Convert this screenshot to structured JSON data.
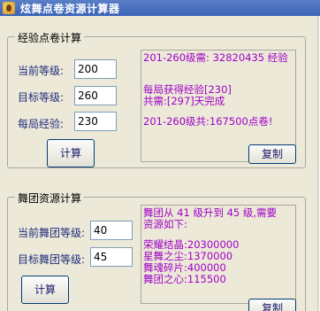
{
  "window": {
    "title": "炫舞点卷资源计算器"
  },
  "exp_group": {
    "title": "经验点卷计算",
    "labels": {
      "current_level": "当前等级:",
      "target_level": "目标等级:",
      "exp_per_round": "每局经验:"
    },
    "values": {
      "current_level": "200",
      "target_level": "260",
      "exp_per_round": "230"
    },
    "calc_label": "计算",
    "copy_label": "复制",
    "output_lines": [
      "201-260级需:  32820435 经验",
      "",
      "每局获得经验[230]",
      "共需:[297]天完成",
      "",
      "201-260级共:167500点卷!"
    ]
  },
  "team_group": {
    "title": "舞团资源计算",
    "labels": {
      "current_team_level": "当前舞团等级:",
      "target_team_level": "目标舞团等级:"
    },
    "values": {
      "current_team_level": "40",
      "target_team_level": "45"
    },
    "calc_label": "计算",
    "copy_label": "复制",
    "output_lines": [
      "舞团从 41 级升到 45 级,需要",
      "资源如下:",
      "",
      "荣耀结晶:20300000",
      "星舞之尘:1370000",
      "舞魂碎片:400000",
      "舞团之心:115500"
    ]
  },
  "colors": {
    "output_text": "#a000c8",
    "label_text": "#1f2c7a",
    "window_bg": "#ece9d8"
  }
}
